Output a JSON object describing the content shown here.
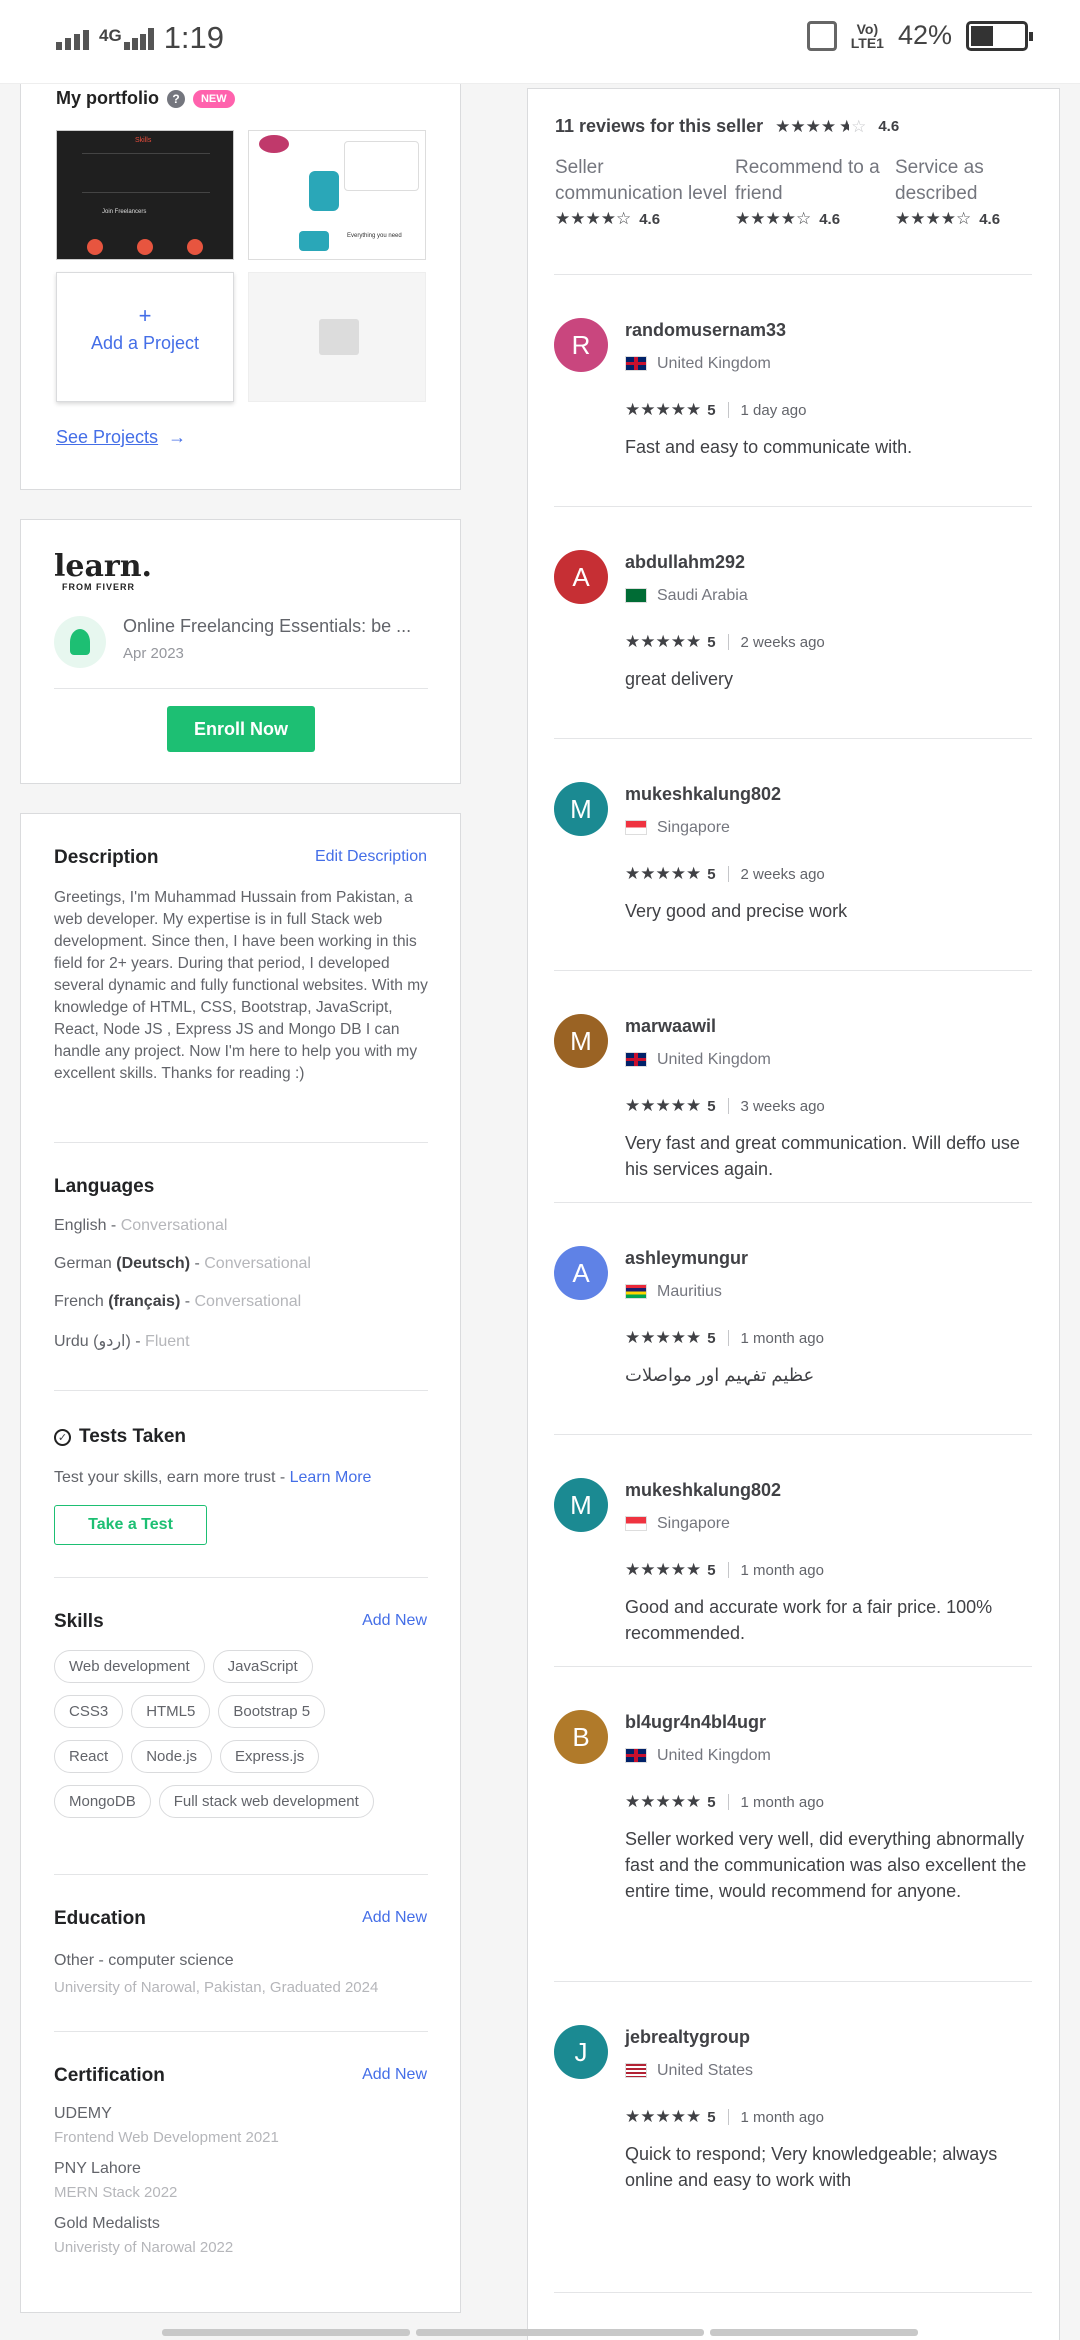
{
  "status_bar": {
    "network": "4G",
    "time": "1:19",
    "volte": "VoLTE1",
    "battery": "42%"
  },
  "portfolio": {
    "title": "My portfolio",
    "help_icon": "?",
    "new_badge": "NEW",
    "add_plus": "+",
    "add_label": "Add a Project",
    "see_projects": "See Projects",
    "thumb1_title": "Skills",
    "thumb1_caption": "Join Freelancers",
    "thumb2_caption": "Everything you need"
  },
  "learn": {
    "logo": "learn.",
    "logo_sub": "FROM FIVERR",
    "course_title": "Online Freelancing Essentials: be ...",
    "course_date": "Apr 2023",
    "enroll": "Enroll Now"
  },
  "description": {
    "title": "Description",
    "edit": "Edit Description",
    "text": "Greetings, I'm Muhammad Hussain from Pakistan, a web developer. My expertise is in full Stack web development. Since then, I have been working in this field for 2+ years. During that period, I developed several dynamic and fully functional websites. With my knowledge of HTML, CSS, Bootstrap, JavaScript, React, Node JS , Express JS and Mongo DB I can handle any project. Now I'm here to help you with my excellent skills. Thanks for reading :)"
  },
  "languages": {
    "title": "Languages",
    "items": [
      {
        "name": "English",
        "native": "",
        "level": "Conversational"
      },
      {
        "name": "German",
        "native": "(Deutsch)",
        "level": "Conversational"
      },
      {
        "name": "French",
        "native": "(français)",
        "level": "Conversational"
      },
      {
        "name": "Urdu",
        "native": "(اردو)",
        "level": "Fluent"
      }
    ]
  },
  "tests": {
    "title": "Tests Taken",
    "text": "Test your skills, earn more trust - ",
    "learn_more": "Learn More",
    "button": "Take a Test"
  },
  "skills": {
    "title": "Skills",
    "add": "Add New",
    "items": [
      "Web development",
      "JavaScript",
      "CSS3",
      "HTML5",
      "Bootstrap 5",
      "React",
      "Node.js",
      "Express.js",
      "MongoDB",
      "Full stack web development"
    ]
  },
  "education": {
    "title": "Education",
    "add": "Add New",
    "degree": "Other - computer science",
    "school": "University of Narowal, Pakistan, Graduated 2024"
  },
  "certification": {
    "title": "Certification",
    "add": "Add New",
    "items": [
      {
        "issuer": "UDEMY",
        "name": "Frontend Web Development 2021"
      },
      {
        "issuer": "PNY Lahore",
        "name": "MERN Stack 2022"
      },
      {
        "issuer": "Gold Medalists",
        "name": "Univeristy of Narowal 2022"
      }
    ]
  },
  "reviews_summary": {
    "title": "11 reviews for this seller",
    "overall": "4.6",
    "breakdown": [
      {
        "label": "Seller communication level",
        "score": "4.6"
      },
      {
        "label": "Recommend to a friend",
        "score": "4.6"
      },
      {
        "label": "Service as described",
        "score": "4.6"
      }
    ]
  },
  "reviews": [
    {
      "initial": "R",
      "color": "#c9467e",
      "user": "randomusernam33",
      "country": "United Kingdom",
      "flag": "uk",
      "score": "5",
      "when": "1 day ago",
      "text": "Fast and easy to communicate with."
    },
    {
      "initial": "A",
      "color": "#c62f34",
      "user": "abdullahm292",
      "country": "Saudi Arabia",
      "flag": "sa",
      "score": "5",
      "when": "2 weeks ago",
      "text": "great delivery"
    },
    {
      "initial": "M",
      "color": "#1b8a92",
      "user": "mukeshkalung802",
      "country": "Singapore",
      "flag": "sg",
      "score": "5",
      "when": "2 weeks ago",
      "text": "Very good and precise work"
    },
    {
      "initial": "M",
      "color": "#9a6324",
      "user": "marwaawil",
      "country": "United Kingdom",
      "flag": "uk",
      "score": "5",
      "when": "3 weeks ago",
      "text": "Very fast and great communication. Will deffo use his services again."
    },
    {
      "initial": "A",
      "color": "#5f82e6",
      "user": "ashleymungur",
      "country": "Mauritius",
      "flag": "mu",
      "score": "5",
      "when": "1 month ago",
      "text": "عظیم تفہیم اور مواصلات"
    },
    {
      "initial": "M",
      "color": "#1b8a92",
      "user": "mukeshkalung802",
      "country": "Singapore",
      "flag": "sg",
      "score": "5",
      "when": "1 month ago",
      "text": "Good and accurate work for a fair price. 100% recommended."
    },
    {
      "initial": "B",
      "color": "#b07a2a",
      "user": "bl4ugr4n4bl4ugr",
      "country": "United Kingdom",
      "flag": "uk",
      "score": "5",
      "when": "1 month ago",
      "text": "Seller worked very well, did everything abnormally fast and the communication was also excellent the entire time, would recommend for anyone."
    },
    {
      "initial": "J",
      "color": "#1b8a92",
      "user": "jebrealtygroup",
      "country": "United States",
      "flag": "us",
      "score": "5",
      "when": "1 month ago",
      "text": "Quick to respond; Very knowledgeable; always online and easy to work with"
    }
  ]
}
